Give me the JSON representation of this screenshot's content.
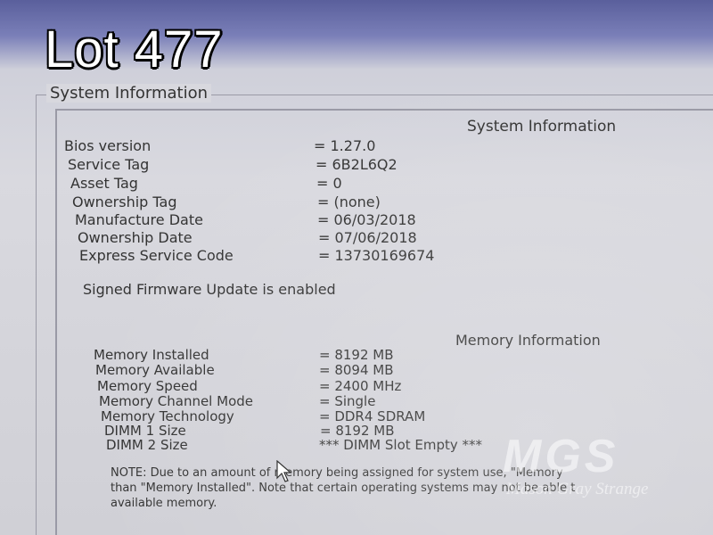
{
  "badge": {
    "lot": "Lot 477"
  },
  "group_title": "System Information",
  "system_info": {
    "heading": "System Information",
    "rows": [
      {
        "label": "Bios version",
        "value": "= 1.27.0"
      },
      {
        "label": "Service Tag",
        "value": "= 6B2L6Q2"
      },
      {
        "label": "Asset Tag",
        "value": "= 0"
      },
      {
        "label": "Ownership Tag",
        "value": "= (none)"
      },
      {
        "label": "Manufacture Date",
        "value": "= 06/03/2018"
      },
      {
        "label": "Ownership Date",
        "value": "= 07/06/2018"
      },
      {
        "label": "Express Service Code",
        "value": "= 13730169674"
      }
    ],
    "firmware_status": "Signed Firmware Update is enabled"
  },
  "memory_info": {
    "heading": "Memory Information",
    "rows": [
      {
        "label": "Memory Installed",
        "value": "= 8192 MB"
      },
      {
        "label": "Memory Available",
        "value": "= 8094 MB"
      },
      {
        "label": "Memory Speed",
        "value": "= 2400 MHz"
      },
      {
        "label": "Memory Channel Mode",
        "value": "= Single"
      },
      {
        "label": "Memory Technology",
        "value": "= DDR4 SDRAM"
      },
      {
        "label": "DIMM 1 Size",
        "value": "= 8192 MB"
      },
      {
        "label": "DIMM 2 Size",
        "value": "*** DIMM Slot Empty ***"
      }
    ],
    "note_lines": [
      "NOTE: Due to an amount of memory being assigned for system use, \"Memory",
      "than \"Memory Installed\". Note that certain operating systems may not be able t",
      "available memory."
    ]
  },
  "watermark": {
    "logo": "MGS",
    "subtitle": "Mason Gray Strange"
  }
}
